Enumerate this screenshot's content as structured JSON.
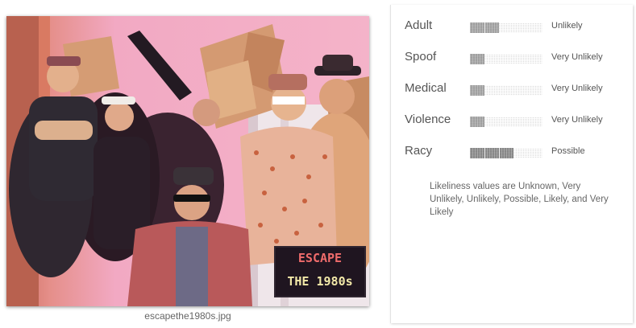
{
  "image": {
    "filename": "escapethe1980s.jpg",
    "sign_line1": "ESCAPE",
    "sign_line2": "THE 1980s"
  },
  "safe_search": {
    "rows": [
      {
        "label": "Adult",
        "value": "Unlikely",
        "level": 0.4
      },
      {
        "label": "Spoof",
        "value": "Very Unlikely",
        "level": 0.2
      },
      {
        "label": "Medical",
        "value": "Very Unlikely",
        "level": 0.2
      },
      {
        "label": "Violence",
        "value": "Very Unlikely",
        "level": 0.2
      },
      {
        "label": "Racy",
        "value": "Possible",
        "level": 0.6
      }
    ],
    "footnote": "Likeliness values are Unknown, Very Unlikely, Unlikely, Possible, Likely, and Very Likely"
  },
  "colors": {
    "background": "#ffffff",
    "photo_pink": "#f1a9c2",
    "meter_fill": "#a8a8a8",
    "text": "#555555"
  }
}
